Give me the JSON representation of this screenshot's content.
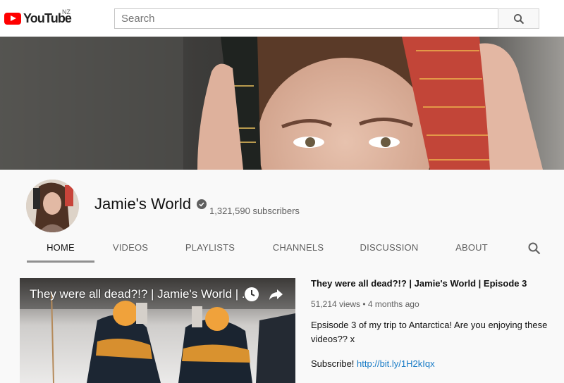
{
  "masthead": {
    "logo_text": "YouTube",
    "country_code": "NZ",
    "search_placeholder": "Search"
  },
  "channel": {
    "name": "Jamie's World",
    "subscribers": "1,321,590 subscribers"
  },
  "tabs": [
    {
      "label": "HOME",
      "active": true
    },
    {
      "label": "VIDEOS",
      "active": false
    },
    {
      "label": "PLAYLISTS",
      "active": false
    },
    {
      "label": "CHANNELS",
      "active": false
    },
    {
      "label": "DISCUSSION",
      "active": false
    },
    {
      "label": "ABOUT",
      "active": false
    }
  ],
  "featured_video": {
    "thumb_title": "They were all dead?!? | Jamie's World | ...",
    "title": "They were all dead?!? | Jamie's World | Episode 3",
    "meta": "51,214 views • 4 months ago",
    "description": "Epsisode 3 of my trip to Antarctica! Are you enjoying these videos?? x",
    "subscribe_prefix": "Subscribe!",
    "subscribe_link": "http://bit.ly/1H2kIqx"
  },
  "colors": {
    "brand_red": "#ff0000",
    "link_blue": "#167ac6",
    "muted_text": "#606060"
  },
  "icons": [
    "search-icon",
    "verified-icon",
    "clock-icon",
    "share-icon"
  ]
}
